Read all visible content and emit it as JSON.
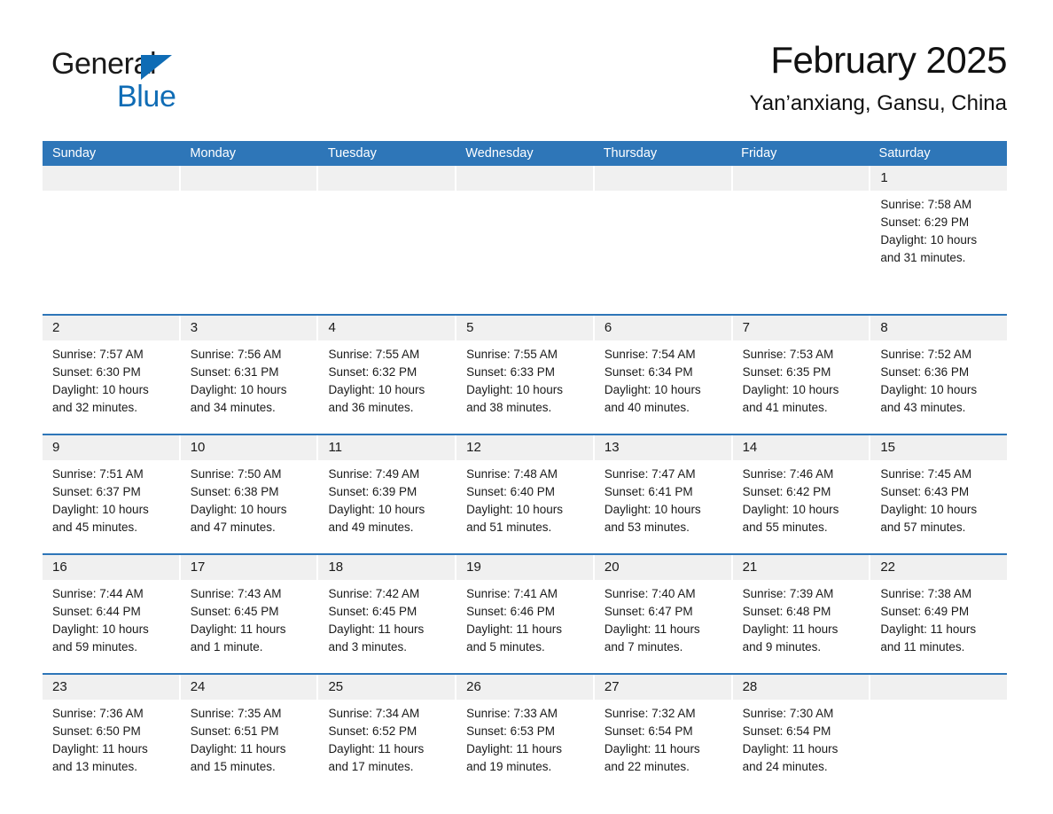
{
  "logo": {
    "word1": "General",
    "word2": "Blue",
    "triangle_color": "#0f6cb5",
    "word2_color": "#0f6cb5"
  },
  "header": {
    "title": "February 2025",
    "location": "Yan’anxiang, Gansu, China"
  },
  "theme": {
    "header_blue": "#2e76b8",
    "daynum_strip": "#f0f0f0",
    "text": "#1a1a1a"
  },
  "weekdays": [
    "Sunday",
    "Monday",
    "Tuesday",
    "Wednesday",
    "Thursday",
    "Friday",
    "Saturday"
  ],
  "weeks": [
    [
      {
        "day": "",
        "sunrise": "",
        "sunset": "",
        "daylight": "",
        "empty": true
      },
      {
        "day": "",
        "sunrise": "",
        "sunset": "",
        "daylight": "",
        "empty": true
      },
      {
        "day": "",
        "sunrise": "",
        "sunset": "",
        "daylight": "",
        "empty": true
      },
      {
        "day": "",
        "sunrise": "",
        "sunset": "",
        "daylight": "",
        "empty": true
      },
      {
        "day": "",
        "sunrise": "",
        "sunset": "",
        "daylight": "",
        "empty": true
      },
      {
        "day": "",
        "sunrise": "",
        "sunset": "",
        "daylight": "",
        "empty": true
      },
      {
        "day": "1",
        "sunrise": "Sunrise: 7:58 AM",
        "sunset": "Sunset: 6:29 PM",
        "daylight": "Daylight: 10 hours and 31 minutes.",
        "empty": false
      }
    ],
    [
      {
        "day": "2",
        "sunrise": "Sunrise: 7:57 AM",
        "sunset": "Sunset: 6:30 PM",
        "daylight": "Daylight: 10 hours and 32 minutes.",
        "empty": false
      },
      {
        "day": "3",
        "sunrise": "Sunrise: 7:56 AM",
        "sunset": "Sunset: 6:31 PM",
        "daylight": "Daylight: 10 hours and 34 minutes.",
        "empty": false
      },
      {
        "day": "4",
        "sunrise": "Sunrise: 7:55 AM",
        "sunset": "Sunset: 6:32 PM",
        "daylight": "Daylight: 10 hours and 36 minutes.",
        "empty": false
      },
      {
        "day": "5",
        "sunrise": "Sunrise: 7:55 AM",
        "sunset": "Sunset: 6:33 PM",
        "daylight": "Daylight: 10 hours and 38 minutes.",
        "empty": false
      },
      {
        "day": "6",
        "sunrise": "Sunrise: 7:54 AM",
        "sunset": "Sunset: 6:34 PM",
        "daylight": "Daylight: 10 hours and 40 minutes.",
        "empty": false
      },
      {
        "day": "7",
        "sunrise": "Sunrise: 7:53 AM",
        "sunset": "Sunset: 6:35 PM",
        "daylight": "Daylight: 10 hours and 41 minutes.",
        "empty": false
      },
      {
        "day": "8",
        "sunrise": "Sunrise: 7:52 AM",
        "sunset": "Sunset: 6:36 PM",
        "daylight": "Daylight: 10 hours and 43 minutes.",
        "empty": false
      }
    ],
    [
      {
        "day": "9",
        "sunrise": "Sunrise: 7:51 AM",
        "sunset": "Sunset: 6:37 PM",
        "daylight": "Daylight: 10 hours and 45 minutes.",
        "empty": false
      },
      {
        "day": "10",
        "sunrise": "Sunrise: 7:50 AM",
        "sunset": "Sunset: 6:38 PM",
        "daylight": "Daylight: 10 hours and 47 minutes.",
        "empty": false
      },
      {
        "day": "11",
        "sunrise": "Sunrise: 7:49 AM",
        "sunset": "Sunset: 6:39 PM",
        "daylight": "Daylight: 10 hours and 49 minutes.",
        "empty": false
      },
      {
        "day": "12",
        "sunrise": "Sunrise: 7:48 AM",
        "sunset": "Sunset: 6:40 PM",
        "daylight": "Daylight: 10 hours and 51 minutes.",
        "empty": false
      },
      {
        "day": "13",
        "sunrise": "Sunrise: 7:47 AM",
        "sunset": "Sunset: 6:41 PM",
        "daylight": "Daylight: 10 hours and 53 minutes.",
        "empty": false
      },
      {
        "day": "14",
        "sunrise": "Sunrise: 7:46 AM",
        "sunset": "Sunset: 6:42 PM",
        "daylight": "Daylight: 10 hours and 55 minutes.",
        "empty": false
      },
      {
        "day": "15",
        "sunrise": "Sunrise: 7:45 AM",
        "sunset": "Sunset: 6:43 PM",
        "daylight": "Daylight: 10 hours and 57 minutes.",
        "empty": false
      }
    ],
    [
      {
        "day": "16",
        "sunrise": "Sunrise: 7:44 AM",
        "sunset": "Sunset: 6:44 PM",
        "daylight": "Daylight: 10 hours and 59 minutes.",
        "empty": false
      },
      {
        "day": "17",
        "sunrise": "Sunrise: 7:43 AM",
        "sunset": "Sunset: 6:45 PM",
        "daylight": "Daylight: 11 hours and 1 minute.",
        "empty": false
      },
      {
        "day": "18",
        "sunrise": "Sunrise: 7:42 AM",
        "sunset": "Sunset: 6:45 PM",
        "daylight": "Daylight: 11 hours and 3 minutes.",
        "empty": false
      },
      {
        "day": "19",
        "sunrise": "Sunrise: 7:41 AM",
        "sunset": "Sunset: 6:46 PM",
        "daylight": "Daylight: 11 hours and 5 minutes.",
        "empty": false
      },
      {
        "day": "20",
        "sunrise": "Sunrise: 7:40 AM",
        "sunset": "Sunset: 6:47 PM",
        "daylight": "Daylight: 11 hours and 7 minutes.",
        "empty": false
      },
      {
        "day": "21",
        "sunrise": "Sunrise: 7:39 AM",
        "sunset": "Sunset: 6:48 PM",
        "daylight": "Daylight: 11 hours and 9 minutes.",
        "empty": false
      },
      {
        "day": "22",
        "sunrise": "Sunrise: 7:38 AM",
        "sunset": "Sunset: 6:49 PM",
        "daylight": "Daylight: 11 hours and 11 minutes.",
        "empty": false
      }
    ],
    [
      {
        "day": "23",
        "sunrise": "Sunrise: 7:36 AM",
        "sunset": "Sunset: 6:50 PM",
        "daylight": "Daylight: 11 hours and 13 minutes.",
        "empty": false
      },
      {
        "day": "24",
        "sunrise": "Sunrise: 7:35 AM",
        "sunset": "Sunset: 6:51 PM",
        "daylight": "Daylight: 11 hours and 15 minutes.",
        "empty": false
      },
      {
        "day": "25",
        "sunrise": "Sunrise: 7:34 AM",
        "sunset": "Sunset: 6:52 PM",
        "daylight": "Daylight: 11 hours and 17 minutes.",
        "empty": false
      },
      {
        "day": "26",
        "sunrise": "Sunrise: 7:33 AM",
        "sunset": "Sunset: 6:53 PM",
        "daylight": "Daylight: 11 hours and 19 minutes.",
        "empty": false
      },
      {
        "day": "27",
        "sunrise": "Sunrise: 7:32 AM",
        "sunset": "Sunset: 6:54 PM",
        "daylight": "Daylight: 11 hours and 22 minutes.",
        "empty": false
      },
      {
        "day": "28",
        "sunrise": "Sunrise: 7:30 AM",
        "sunset": "Sunset: 6:54 PM",
        "daylight": "Daylight: 11 hours and 24 minutes.",
        "empty": false
      },
      {
        "day": "",
        "sunrise": "",
        "sunset": "",
        "daylight": "",
        "empty": true
      }
    ]
  ]
}
